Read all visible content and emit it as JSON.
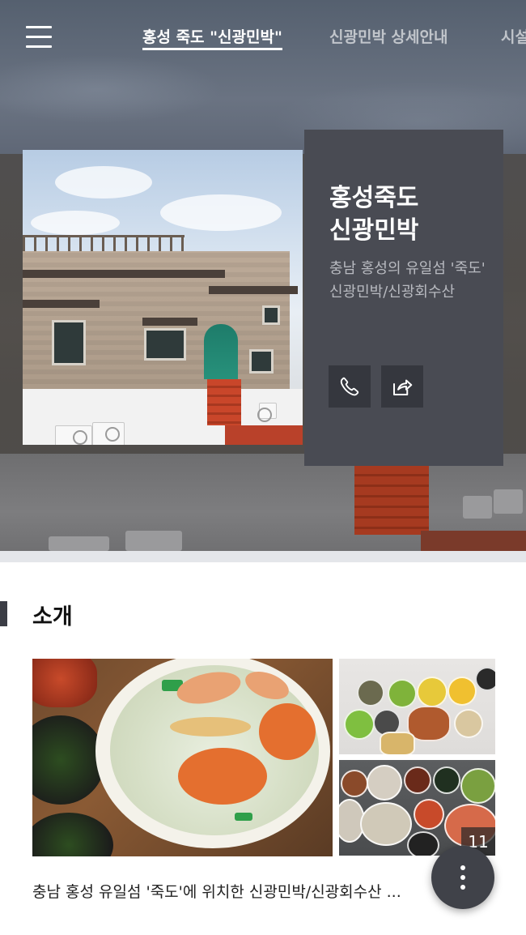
{
  "nav": {
    "menu_icon": "hamburger-menu-icon",
    "tabs": [
      {
        "label": "홍성 죽도 \"신광민박\"",
        "active": true
      },
      {
        "label": "신광민박 상세안내",
        "active": false
      },
      {
        "label": "시설",
        "active": false
      }
    ]
  },
  "hero": {
    "title_line1": "홍성죽도",
    "title_line2": "신광민박",
    "description": "충남 홍성의 유일섬 '죽도' 신광민박/신광회수산",
    "actions": [
      {
        "icon": "phone-icon"
      },
      {
        "icon": "share-icon"
      }
    ]
  },
  "intro": {
    "section_title": "소개",
    "photo_count": "11",
    "text": "충남 홍성 유일섬 '죽도'에 위치한 신광민박/신광회수산 ..."
  },
  "fab": {
    "icon": "more-vertical-icon"
  },
  "colors": {
    "info_card": "#494b53",
    "separator": "#e4e6ea",
    "fab": "#404249"
  }
}
